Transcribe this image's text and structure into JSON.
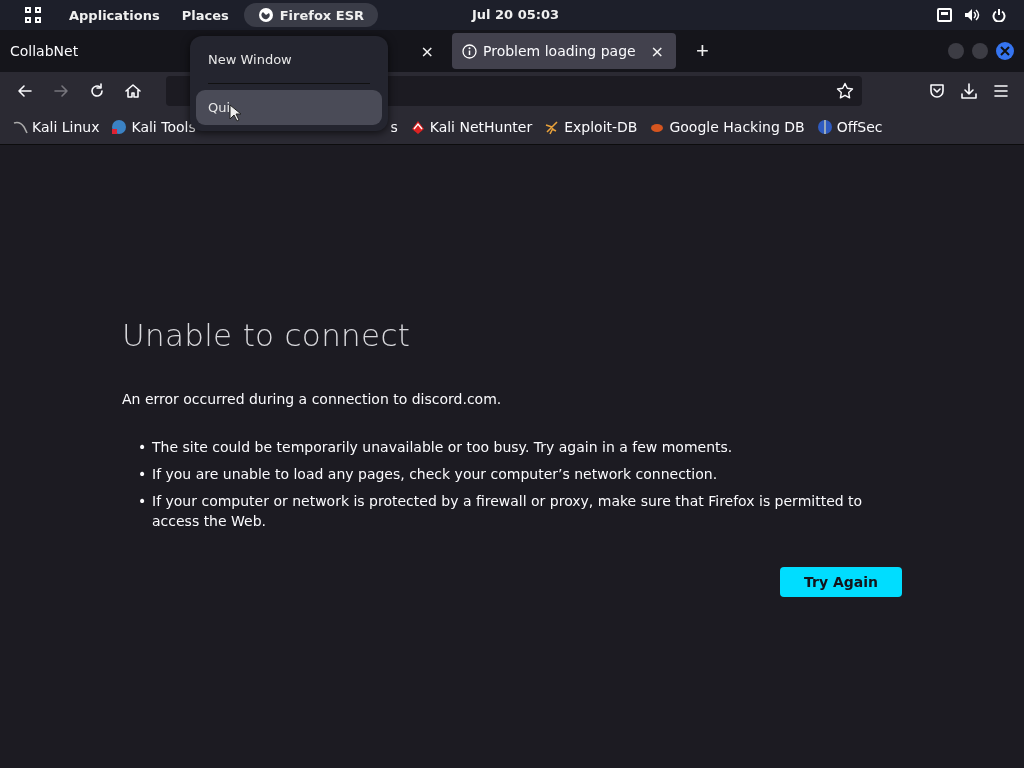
{
  "top_panel": {
    "menus": [
      "Applications",
      "Places"
    ],
    "active_app": "Firefox ESR",
    "clock": "Jul 20  05:03"
  },
  "tabs": [
    {
      "title": "CollabNet",
      "selected": false,
      "kind": "plain",
      "close": "×"
    },
    {
      "title": "Problem loading page",
      "selected": true,
      "kind": "info",
      "close": "×"
    }
  ],
  "new_tab": "+",
  "bookmarks": [
    {
      "label": "Kali Linux",
      "kind": "kali"
    },
    {
      "label": "Kali Tools",
      "kind": "tools"
    },
    {
      "label": "s",
      "kind": "hidden"
    },
    {
      "label": "Kali NetHunter",
      "kind": "nethunter"
    },
    {
      "label": "Exploit-DB",
      "kind": "exploit"
    },
    {
      "label": "Google Hacking DB",
      "kind": "ghdb"
    },
    {
      "label": "OffSec",
      "kind": "offsec"
    }
  ],
  "app_menu": {
    "items": [
      {
        "label": "New Window",
        "selected": false
      },
      {
        "label": "Qui",
        "selected": true
      }
    ]
  },
  "error": {
    "title": "Unable to connect",
    "message": "An error occurred during a connection to discord.com.",
    "bullets": [
      {
        "marker": "•",
        "text": "The site could be temporarily unavailable or too busy. Try again in a few moments."
      },
      {
        "marker": "•",
        "text": "If you are unable to load any pages, check your computer’s network connection."
      },
      {
        "marker": "•",
        "text": "If your computer or network is protected by a firewall or proxy, make sure that Firefox is permitted to access the Web."
      }
    ],
    "button": "Try Again"
  }
}
